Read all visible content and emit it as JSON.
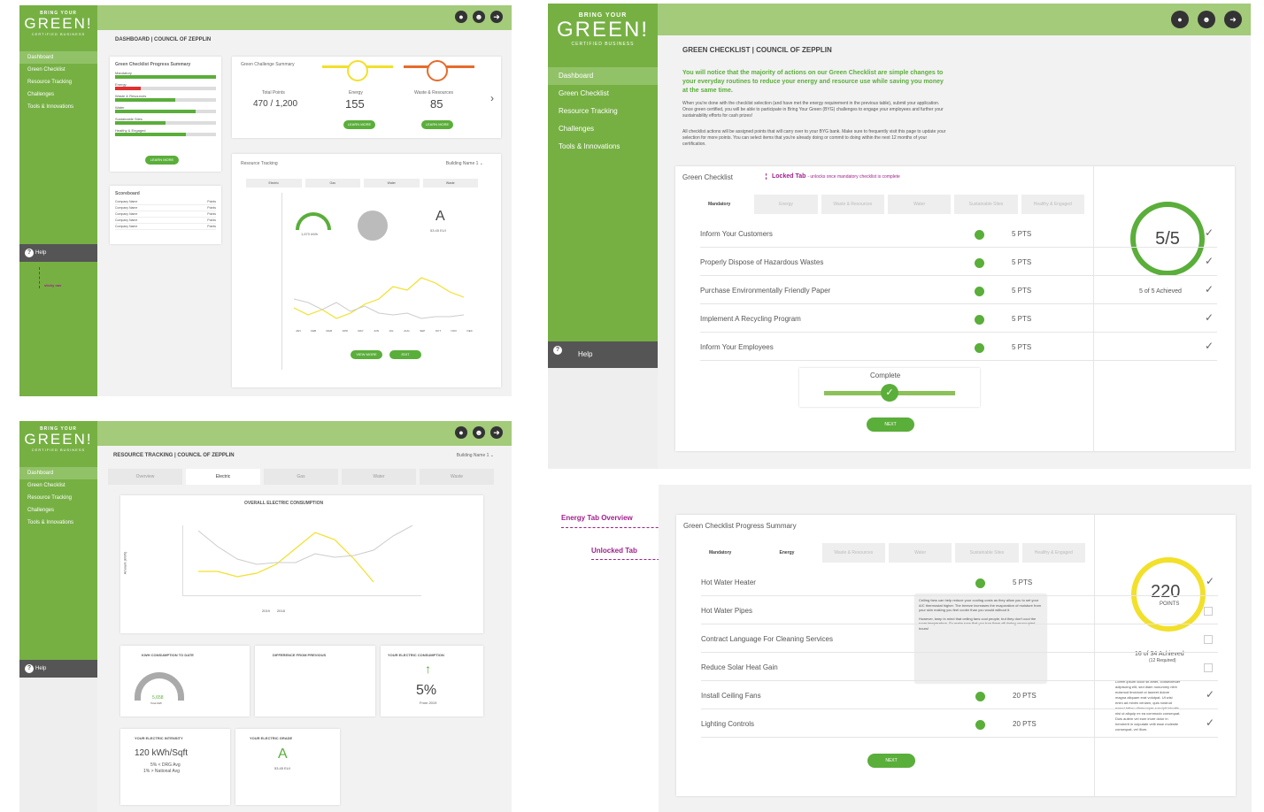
{
  "brand": {
    "line1": "BRING YOUR",
    "line2": "GREEN!",
    "line3": "CERTIFIED BUSINESS"
  },
  "nav": [
    "Dashboard",
    "Green Checklist",
    "Resource Tracking",
    "Challenges",
    "Tools & Innovations"
  ],
  "help": "Help",
  "colors": {
    "green": "#76b043",
    "accent": "#5aae3a",
    "yellow": "#f2e02a",
    "purple": "#a0208c",
    "orange": "#e66b2b"
  },
  "p1": {
    "crumb": "DASHBOARD | COUNCIL OF ZEPPLIN",
    "progress_title": "Green Checklist Progress Summary",
    "progress": [
      {
        "label": "Mandatory",
        "v": 1.0
      },
      {
        "label": "Energy",
        "v": 0.25
      },
      {
        "label": "Waste & Resources",
        "v": 0.6
      },
      {
        "label": "Water",
        "v": 0.8
      },
      {
        "label": "Sustainable Sites",
        "v": 0.5
      },
      {
        "label": "Healthy & Engaged",
        "v": 0.7
      }
    ],
    "learn_more": "LEARN MORE",
    "challenge_title": "Green Challenge Summary",
    "total_label": "Total Points",
    "total": "470",
    "total_max": "1,200",
    "energy_label": "Energy",
    "energy_val": "155",
    "waste_label": "Waste & Resources",
    "waste_val": "85",
    "points": "POINTS",
    "scoreboard": "Scoreboard",
    "company": "Company Name",
    "pts": "Points",
    "rt_title": "Resource Tracking",
    "building": "Building Name 1 ⌄",
    "rt_tabs": [
      "Electric",
      "Gas",
      "Water",
      "Waste"
    ],
    "kwh": "1,670 kWh",
    "grade": "A",
    "eui": "53.45 EUI",
    "months": [
      "JAN",
      "FEB",
      "MAR",
      "APR",
      "MAY",
      "JUN",
      "JUL",
      "AUG",
      "SEP",
      "OCT",
      "NOV",
      "DEC"
    ],
    "view_more": "VIEW MORE",
    "edit": "EDIT",
    "sticky": "sticky nav"
  },
  "p2": {
    "crumb": "GREEN CHECKLIST | COUNCIL OF ZEPPLIN",
    "intro": "You will notice that the majority of actions on our Green Checklist are simple changes to your everyday routines to reduce your energy and resource use while saving you money at the same time.",
    "para1": "When you're done with the checklist selection (and have met the energy requirement in the previous table), submit your application. Once green certified, you will be able to participate in Bring Your Green (BYG) challenges to engage your employees and further your sustainability efforts for cash prizes!",
    "para2": "All checklist actions will be assigned points that will carry over to your BYG bank. Make sure to frequently visit this page to update your selection for more points. You can select items that you're already doing or commit to doing within the next 12 months of your certification.",
    "gc": "Green Checklist",
    "locked": "Locked Tab",
    "locked_note": "- unlocks once mandatory checklist is complete",
    "tabs": [
      "Mandatory",
      "Energy",
      "Waste & Resources",
      "Water",
      "Sustainable Sites",
      "Healthy & Engaged"
    ],
    "items": [
      {
        "t": "Inform Your Customers",
        "p": "5 PTS"
      },
      {
        "t": "Properly Dispose of Hazardous Wastes",
        "p": "5 PTS"
      },
      {
        "t": "Purchase Environmentally Friendly Paper",
        "p": "5 PTS"
      },
      {
        "t": "Implement A Recycling Program",
        "p": "5 PTS"
      },
      {
        "t": "Inform Your Employees",
        "p": "5 PTS"
      }
    ],
    "complete": "Complete",
    "next": "NEXT",
    "score": "5/5",
    "achieved": "5 of 5 Achieved"
  },
  "p3": {
    "crumb": "RESOURCE TRACKING | COUNCIL OF ZEPPLIN",
    "building": "Building Name 1 ⌄",
    "tabs": [
      "Overview",
      "Electric",
      "Gas",
      "Water",
      "Waste"
    ],
    "chart_title": "OVERALL ELECTRIC CONSUMPTION",
    "ylabel": "Amount (kWh)",
    "legend": [
      "2019",
      "2018"
    ],
    "k1": "KWH CONSUMPTION TO DATE",
    "k1v": "5,658",
    "k1s": "Total kWh",
    "k2": "DIFFERENCE FROM PREVIOUS",
    "k3": "YOUR ELECTRIC CONSUMPTION",
    "k3v": "5%",
    "k3s": "From 2019",
    "k4": "YOUR ELECTRIC INTENSITY",
    "k4v": "120 kWh/Sqft",
    "k4a": "5% < DRG Avg",
    "k4b": "1% > National Avg",
    "k5": "YOUR ELECTRIC GRADE",
    "k5v": "A",
    "k5s": "53.45 EUI"
  },
  "p4": {
    "energy_note": "Energy Tab Overview",
    "unlocked": "Unlocked Tab",
    "title": "Green Checklist Progress Summary",
    "items": [
      {
        "t": "Hot Water Heater",
        "p": "5 PTS",
        "c": true
      },
      {
        "t": "Hot Water Pipes",
        "p": "",
        "c": false
      },
      {
        "t": "Contract Language For Cleaning Services",
        "p": "",
        "c": false
      },
      {
        "t": "Reduce Solar Heat Gain",
        "p": "",
        "c": false
      },
      {
        "t": "Install Ceiling Fans",
        "p": "20 PTS",
        "c": true
      },
      {
        "t": "Lighting Controls",
        "p": "20 PTS",
        "c": true
      }
    ],
    "tip1": "Ceiling fans can help reduce your cooling costs as they allow you to set your A/C thermostat higher. The breeze increases the evaporation of moisture from your skin making you feel cooler than you would without it.",
    "tip2": "However, keep in mind that ceiling fans cool people, but they don't cool the room temperature. So make sure that you turn them off during unoccupied hours!",
    "score": "220",
    "points": "POINTS",
    "achieved": "16 of 34 Achieved",
    "required": "(12 Required)",
    "lorem": "Lorem ipsum dolor sit amet, consectetuer adipiscing elit, sed diam nonummy nibh euismod tincidunt ut laoreet dolore magna aliquam erat volutpat. Ut wisi enim ad minim veniam, quis nostrud exerci tation ullamcorper suscipit lobortis nisl ut aliquip ex ea commodo consequat. Duis autem vel eum iriure dolor in hendrerit in vulputate velit esse molestie consequat, vel illum."
  }
}
